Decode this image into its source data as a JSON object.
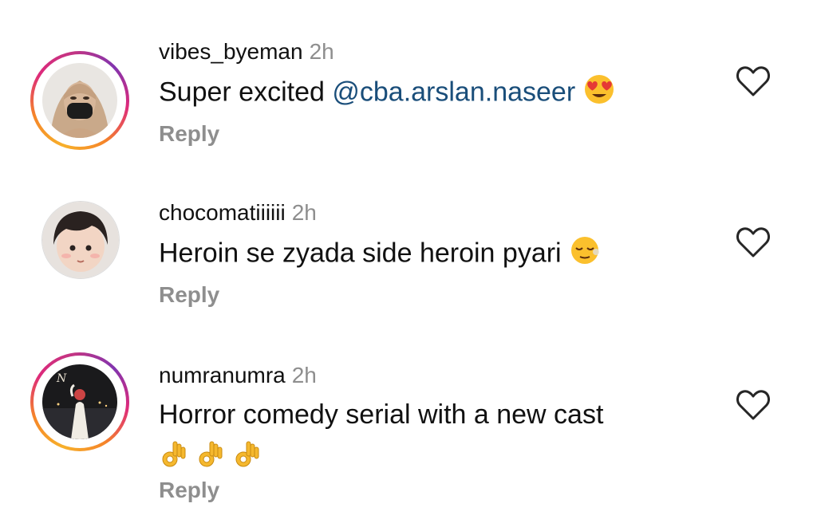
{
  "comments": [
    {
      "username": "vibes_byeman",
      "time": "2h",
      "text": "Super excited ",
      "mention": "@cba.arslan.naseer",
      "emoji": "heart-eyes",
      "reply": "Reply",
      "has_story_ring": true
    },
    {
      "username": "chocomatiiiiii",
      "time": "2h",
      "text": "Heroin se zyada side heroin pyari",
      "emoji": "relieved-face",
      "reply": "Reply",
      "has_story_ring": false
    },
    {
      "username": "numranumra",
      "time": "2h",
      "text": "Horror comedy serial with a new cast",
      "emoji": "ok-hand x3",
      "reply": "Reply",
      "has_story_ring": true
    }
  ],
  "colors": {
    "mention": "#1a4e7a",
    "muted": "#8e8e8e",
    "text": "#111111"
  },
  "icons": [
    "heart-outline-icon",
    "heart-eyes-emoji",
    "relieved-face-emoji",
    "ok-hand-emoji"
  ]
}
